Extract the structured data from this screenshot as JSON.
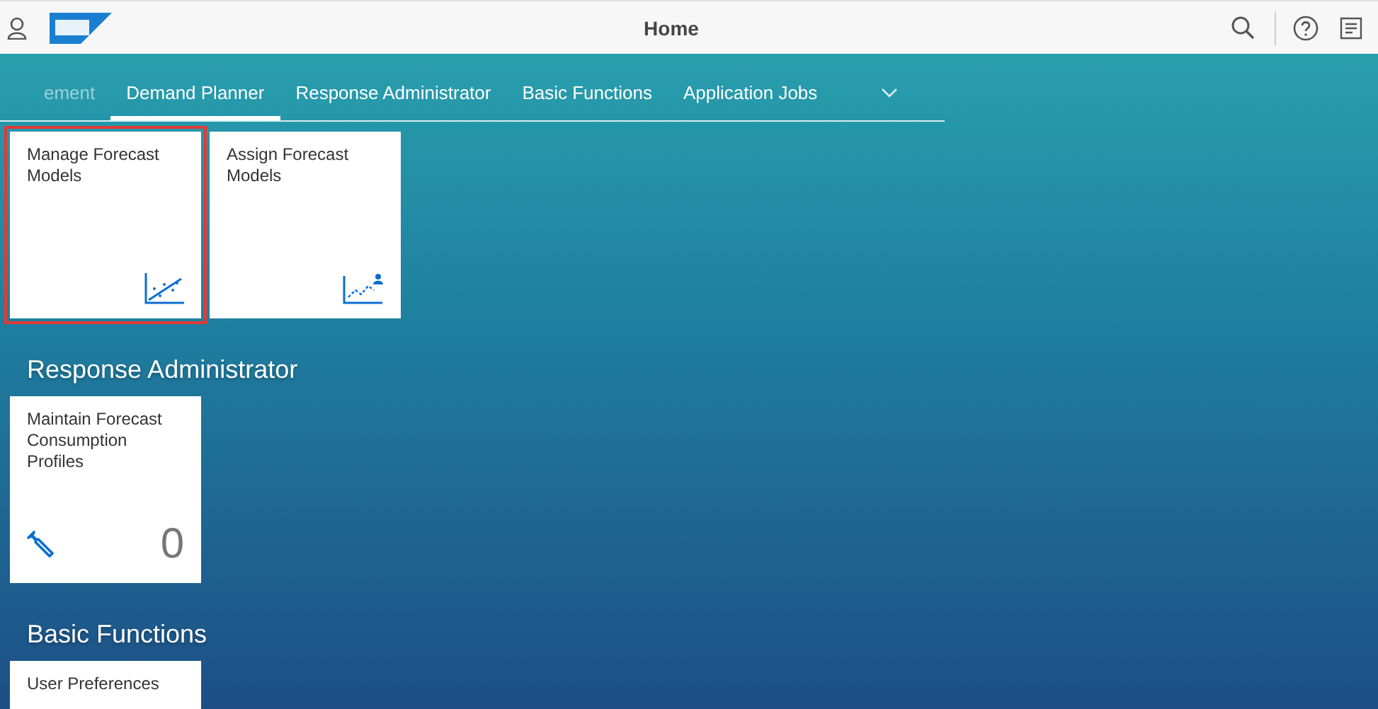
{
  "header": {
    "title": "Home"
  },
  "tabs": [
    {
      "label": "ement",
      "selected": false,
      "faded": true
    },
    {
      "label": "Demand Planner",
      "selected": true,
      "faded": false
    },
    {
      "label": "Response Administrator",
      "selected": false,
      "faded": false
    },
    {
      "label": "Basic Functions",
      "selected": false,
      "faded": false
    },
    {
      "label": "Application Jobs",
      "selected": false,
      "faded": false
    }
  ],
  "sections": [
    {
      "tiles": [
        {
          "kind": "trend",
          "title": "Manage Forecast Models",
          "highlighted": true
        },
        {
          "kind": "assign",
          "title": "Assign Forecast Models",
          "highlighted": false
        }
      ]
    },
    {
      "title": "Response Administrator",
      "tiles": [
        {
          "kind": "kpi",
          "title": "Maintain Forecast Consumption Profiles",
          "number": "0",
          "highlighted": false
        }
      ]
    },
    {
      "title": "Basic Functions",
      "tiles": [
        {
          "kind": "plain",
          "title": "User Preferences",
          "highlighted": false
        }
      ]
    }
  ]
}
